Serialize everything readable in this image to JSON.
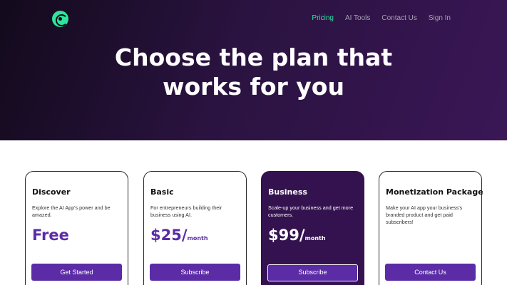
{
  "nav": {
    "items": [
      {
        "label": "Pricing",
        "active": true
      },
      {
        "label": "AI Tools",
        "active": false
      },
      {
        "label": "Contact Us",
        "active": false
      },
      {
        "label": "Sign In",
        "active": false
      }
    ]
  },
  "hero": {
    "line1": "Choose the plan that",
    "line2": "works for you"
  },
  "plans": [
    {
      "title": "Discover",
      "description": "Explore the AI App's power and be amazed.",
      "price": "Free",
      "unit": "",
      "button": "Get Started"
    },
    {
      "title": "Basic",
      "description": "For entrepreneurs building their business using AI.",
      "price": "$25/",
      "unit": "month",
      "button": "Subscribe"
    },
    {
      "title": "Business",
      "description": "Scale-up your business and get more customers.",
      "price": "$99/",
      "unit": "month",
      "button": "Subscribe"
    },
    {
      "title": "Monetization Package",
      "description": "Make your AI app your business's branded product and get paid subscribers!",
      "price": "",
      "unit": "",
      "button": "Contact Us"
    }
  ],
  "colors": {
    "accent": "#5b2ca6",
    "nav_active": "#2ee59d",
    "featured_bg": "#34124f",
    "hero_bg": "#2a1340"
  },
  "icons": {
    "logo": "logo-icon"
  }
}
